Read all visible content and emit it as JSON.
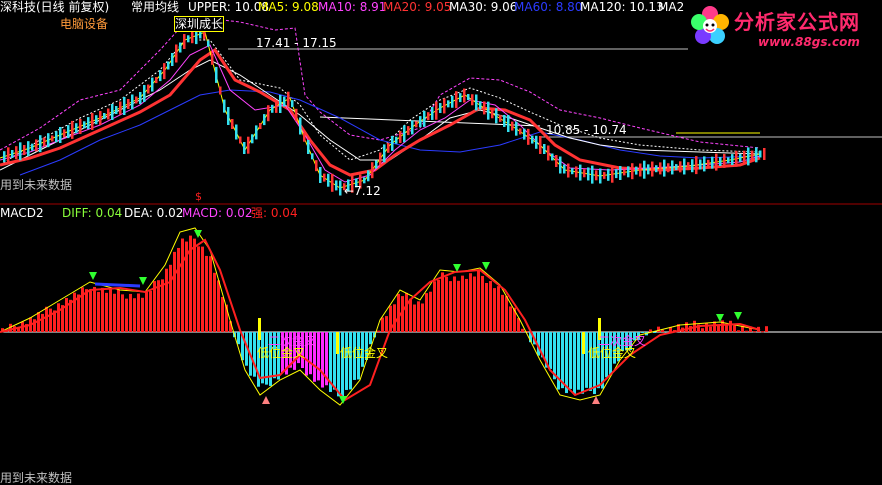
{
  "header": {
    "title": "深科技(日线 前复权)",
    "indicator_name": "常用均线",
    "upper": "UPPER: 10.08",
    "ma5": "MA5: 9.08",
    "ma10": "MA10: 8.91",
    "ma20": "MA20: 9.05",
    "ma30": "MA30: 9.06",
    "ma60": "MA60: 8.80",
    "ma120": "MA120: 10.13",
    "ma2_partial": "MA2"
  },
  "price_panel": {
    "sector_label": "电脑设备",
    "buy_signal_label": "深圳成长",
    "range_label_1": "17.41 - 17.15",
    "range_label_2": "10.85 - 10.74",
    "low_label": "←7.12",
    "future_data_note": "用到未来数据",
    "dollar_marker": "$"
  },
  "macd_panel": {
    "name": "MACD2",
    "diff": "DIFF: 0.04",
    "dea": "DEA: 0.02",
    "macd": "MACD: 0.02",
    "strength": "强: 0.04",
    "second_cross_1": "二次金叉",
    "low_cross_1": "低位金叉",
    "low_cross_2": "低位金叉",
    "second_cross_2": "二次金叉",
    "low_cross_3": "低位金叉",
    "future_data_note": "用到未来数据"
  },
  "logo": {
    "name": "分析家公式网",
    "url": "www.88gs.com"
  },
  "colors": {
    "upper": "#ffffff",
    "ma5": "#ffff00",
    "ma10": "#ff44ff",
    "ma20": "#ff3333",
    "ma30": "#ffffff",
    "ma60": "#2b3bff",
    "ma120": "#ffffff",
    "diff": "#ffff00",
    "dea": "#ff2020",
    "macd_pos": "#ff2020",
    "macd_neg": "#33e0f0",
    "macd_neg_alt": "#ff2aff"
  },
  "chart_data": [
    {
      "type": "line",
      "title": "",
      "series": [
        {
          "name": "MA5",
          "last": 9.08
        },
        {
          "name": "MA10",
          "last": 8.91
        },
        {
          "name": "MA20",
          "last": 9.05
        },
        {
          "name": "MA30",
          "last": 9.06
        },
        {
          "name": "MA60",
          "last": 8.8
        },
        {
          "name": "MA120",
          "last": 10.13
        },
        {
          "name": "UPPER",
          "last": 10.08
        }
      ],
      "annotations": [
        "17.41 - 17.15",
        "10.85 - 10.74",
        "←7.12"
      ]
    },
    {
      "type": "bar",
      "title": "MACD2",
      "series": [
        {
          "name": "DIFF",
          "last": 0.04
        },
        {
          "name": "DEA",
          "last": 0.02
        },
        {
          "name": "MACD",
          "last": 0.02
        },
        {
          "name": "强",
          "last": 0.04
        }
      ]
    }
  ]
}
